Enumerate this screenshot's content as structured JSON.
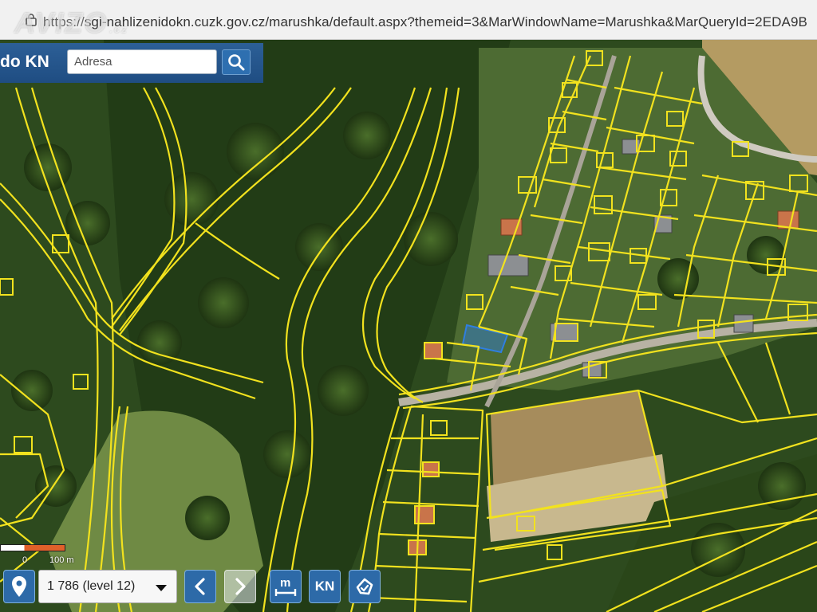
{
  "browser": {
    "url_prefix": "https://",
    "url": "sgi-nahlizenidokn.cuzk.gov.cz/marushka/default.aspx?themeid=3&MarWindowName=Marushka&MarQueryId=2EDA9B",
    "watermark": "AVIZO",
    "watermark_suffix": ".cz"
  },
  "app": {
    "title": "do KN",
    "search_placeholder": "Adresa",
    "search_icon": "search-icon"
  },
  "map": {
    "scale_labels": [
      "0",
      "100 m"
    ],
    "parcel_line_color": "#f2e21e",
    "selected_parcel_color": "#2f7fe0"
  },
  "toolbar": {
    "location_icon": "location-pin-icon",
    "zoom_level": "1 786 (level 12)",
    "back_icon": "chevron-left-icon",
    "forward_icon": "chevron-right-icon",
    "measure_icon": "measure-icon",
    "kn_label": "KN",
    "polygon_icon": "polygon-icon"
  }
}
